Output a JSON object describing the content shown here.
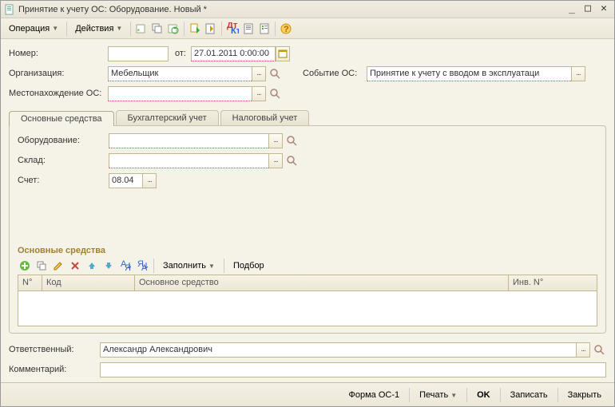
{
  "window": {
    "title": "Принятие к учету ОС: Оборудование. Новый *"
  },
  "toolbar": {
    "operation": "Операция",
    "actions": "Действия"
  },
  "form": {
    "number_lbl": "Номер:",
    "number_val": "",
    "from_lbl": "от:",
    "date_val": "27.01.2011 0:00:00",
    "org_lbl": "Организация:",
    "org_val": "Мебельщик",
    "event_lbl": "Событие ОС:",
    "event_val": "Принятие к учету с вводом в эксплуатаци",
    "location_lbl": "Местонахождение ОС:",
    "location_val": ""
  },
  "tabs": {
    "main": "Основные средства",
    "accounting": "Бухгалтерский учет",
    "tax": "Налоговый учет"
  },
  "tabmain": {
    "equip_lbl": "Оборудование:",
    "equip_val": "",
    "store_lbl": "Склад:",
    "store_val": "",
    "account_lbl": "Счет:",
    "account_val": "08.04",
    "section": "Основные средства",
    "fill": "Заполнить",
    "select": "Подбор",
    "col_n": "N°",
    "col_code": "Код",
    "col_os": "Основное средство",
    "col_inv": "Инв. N°"
  },
  "footer": {
    "resp_lbl": "Ответственный:",
    "resp_val": "Александр Александрович",
    "comment_lbl": "Комментарий:",
    "comment_val": ""
  },
  "bottom": {
    "form_os1": "Форма ОС-1",
    "print": "Печать",
    "ok": "OK",
    "save": "Записать",
    "close": "Закрыть"
  }
}
